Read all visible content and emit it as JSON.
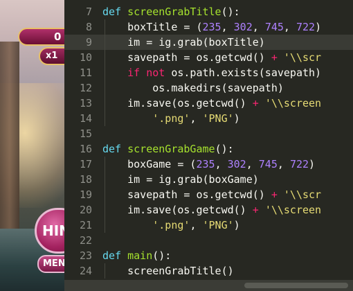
{
  "game": {
    "score_text": "0",
    "multiplier_text": "x1",
    "hint_label": "HIN",
    "menu_label": "MEN"
  },
  "editor": {
    "lines": [
      {
        "num": "7",
        "tokens": [
          [
            "def ",
            "kw"
          ],
          [
            "screenGrabTitle",
            "fn"
          ],
          [
            "():",
            ""
          ]
        ]
      },
      {
        "num": "8",
        "tokens": [
          [
            "    boxTitle ",
            ""
          ],
          [
            "=",
            ""
          ],
          [
            " (",
            ""
          ],
          [
            "235",
            "num"
          ],
          [
            ", ",
            ""
          ],
          [
            "302",
            "num"
          ],
          [
            ", ",
            ""
          ],
          [
            "745",
            "num"
          ],
          [
            ", ",
            ""
          ],
          [
            "722",
            "num"
          ],
          [
            ")",
            ""
          ]
        ]
      },
      {
        "num": "9",
        "tokens": [
          [
            "    im = ig.grab(boxTitle)",
            ""
          ]
        ]
      },
      {
        "num": "10",
        "tokens": [
          [
            "    savepath = os.getcwd() ",
            ""
          ],
          [
            "+",
            "op"
          ],
          [
            " ",
            ""
          ],
          [
            "'\\\\scr",
            "str"
          ]
        ]
      },
      {
        "num": "11",
        "tokens": [
          [
            "    ",
            ""
          ],
          [
            "if not",
            "kwp"
          ],
          [
            " os.path.exists(savepath)",
            ""
          ]
        ]
      },
      {
        "num": "12",
        "tokens": [
          [
            "        os.makedirs(savepath)",
            ""
          ]
        ]
      },
      {
        "num": "13",
        "tokens": [
          [
            "    im.save(os.getcwd() ",
            ""
          ],
          [
            "+",
            "op"
          ],
          [
            " ",
            ""
          ],
          [
            "'\\\\screen",
            "str"
          ]
        ]
      },
      {
        "num": "14",
        "tokens": [
          [
            "        ",
            ""
          ],
          [
            "'.png'",
            "str"
          ],
          [
            ", ",
            ""
          ],
          [
            "'PNG'",
            "str"
          ],
          [
            ")",
            ""
          ]
        ]
      },
      {
        "num": "15",
        "tokens": []
      },
      {
        "num": "16",
        "tokens": [
          [
            "def ",
            "kw"
          ],
          [
            "screenGrabGame",
            "fn"
          ],
          [
            "():",
            ""
          ]
        ]
      },
      {
        "num": "17",
        "tokens": [
          [
            "    boxGame = (",
            ""
          ],
          [
            "235",
            "num"
          ],
          [
            ", ",
            ""
          ],
          [
            "302",
            "num"
          ],
          [
            ", ",
            ""
          ],
          [
            "745",
            "num"
          ],
          [
            ", ",
            ""
          ],
          [
            "722",
            "num"
          ],
          [
            ")",
            ""
          ]
        ]
      },
      {
        "num": "18",
        "tokens": [
          [
            "    im = ig.grab(boxGame)",
            ""
          ]
        ]
      },
      {
        "num": "19",
        "tokens": [
          [
            "    savepath = os.getcwd() ",
            ""
          ],
          [
            "+",
            "op"
          ],
          [
            " ",
            ""
          ],
          [
            "'\\\\scr",
            "str"
          ]
        ]
      },
      {
        "num": "20",
        "tokens": [
          [
            "    im.save(os.getcwd() ",
            ""
          ],
          [
            "+",
            "op"
          ],
          [
            " ",
            ""
          ],
          [
            "'\\\\screen",
            "str"
          ]
        ]
      },
      {
        "num": "21",
        "tokens": [
          [
            "        ",
            ""
          ],
          [
            "'.png'",
            "str"
          ],
          [
            ", ",
            ""
          ],
          [
            "'PNG'",
            "str"
          ],
          [
            ")",
            ""
          ]
        ]
      },
      {
        "num": "22",
        "tokens": []
      },
      {
        "num": "23",
        "tokens": [
          [
            "def ",
            "kw"
          ],
          [
            "main",
            "fn"
          ],
          [
            "():",
            ""
          ]
        ]
      },
      {
        "num": "24",
        "tokens": [
          [
            "    screenGrabTitle()",
            ""
          ]
        ]
      }
    ],
    "active_line": "9"
  }
}
